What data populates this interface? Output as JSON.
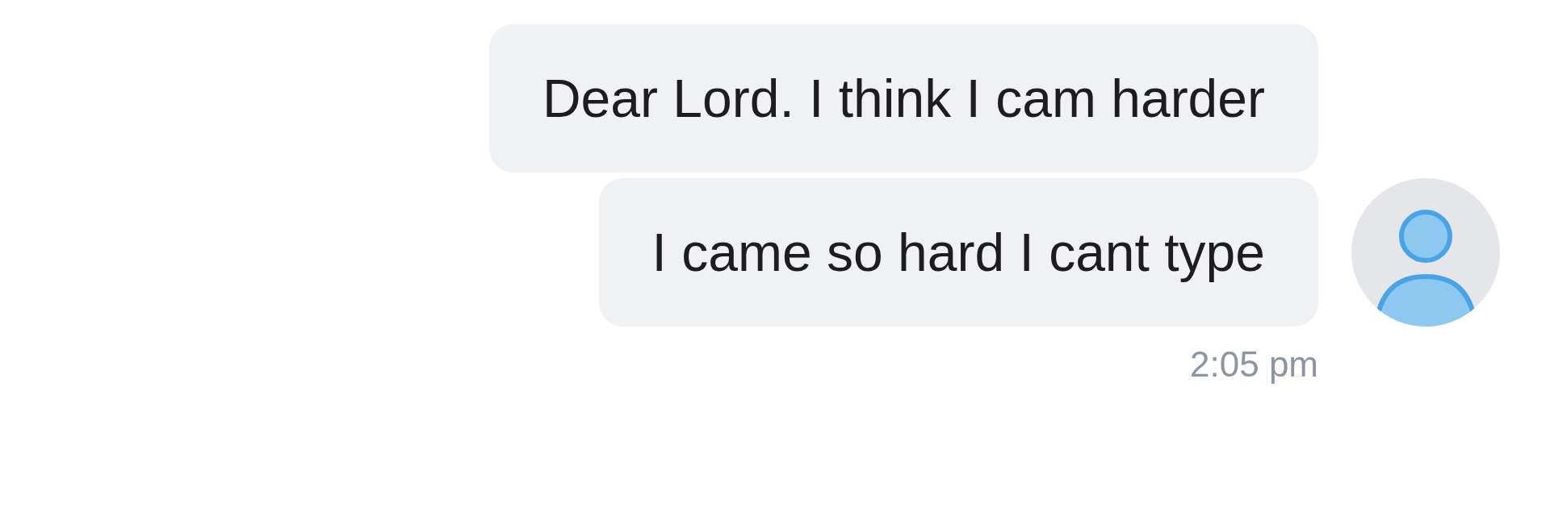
{
  "messages": [
    {
      "text": "Dear Lord. I think I cam harder"
    },
    {
      "text": "I came so hard I cant type"
    }
  ],
  "timestamp": "2:05 pm"
}
